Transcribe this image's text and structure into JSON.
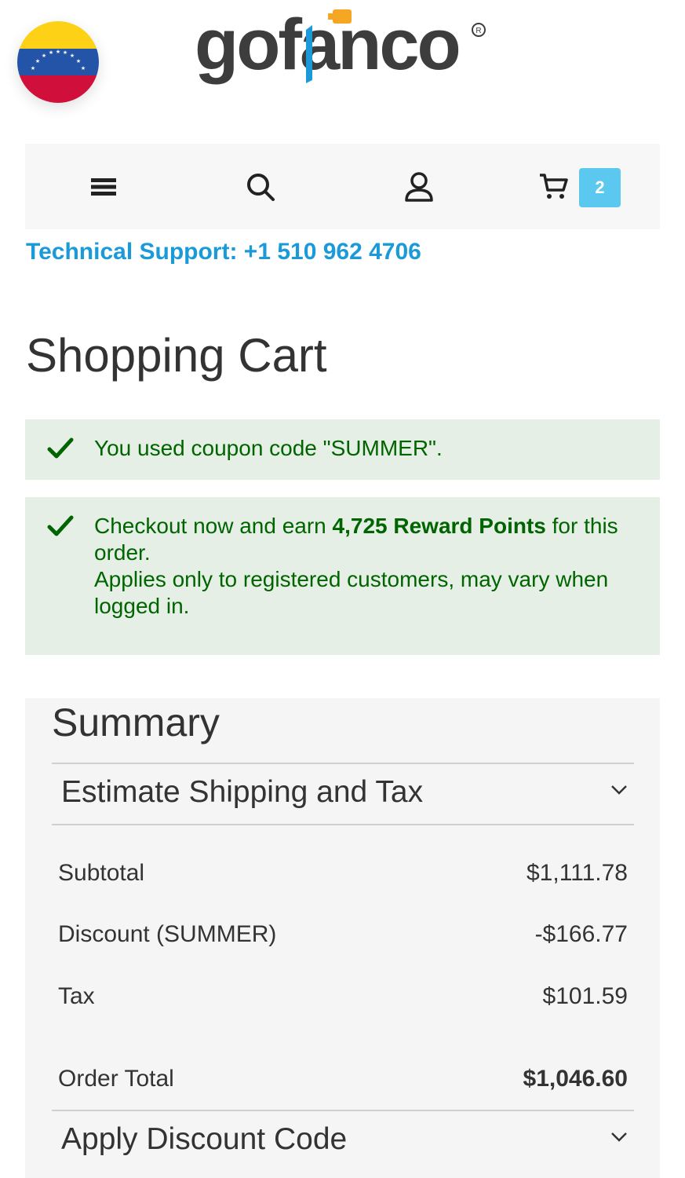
{
  "header": {
    "flag": "venezuela-flag",
    "logo_text": "gofanco",
    "registered_mark": "®"
  },
  "nav": {
    "menu_icon": "menu-icon",
    "search_icon": "search-icon",
    "account_icon": "user-icon",
    "cart_icon": "cart-icon",
    "cart_count": "2"
  },
  "support": {
    "text": "Technical Support: +1 510 962 4706"
  },
  "page": {
    "title": "Shopping Cart"
  },
  "messages": {
    "coupon": "You used coupon code \"SUMMER\".",
    "reward_prefix": "Checkout now and earn ",
    "reward_points": "4,725 Reward Points",
    "reward_suffix": " for this order.",
    "reward_note": "Applies only to registered customers, may vary when logged in."
  },
  "summary": {
    "title": "Summary",
    "shipping_label": "Estimate Shipping and Tax",
    "rows": [
      {
        "label": "Subtotal",
        "value": "$1,111.78"
      },
      {
        "label": "Discount (SUMMER)",
        "value": "-$166.77"
      },
      {
        "label": "Tax",
        "value": "$101.59"
      }
    ],
    "total_label": "Order Total",
    "total_value": "$1,046.60",
    "discount_label": "Apply Discount Code"
  },
  "colors": {
    "accent": "#1a9ad8",
    "badge": "#5bc8ef",
    "success_bg": "#e5efe5",
    "success_text": "#006400"
  }
}
